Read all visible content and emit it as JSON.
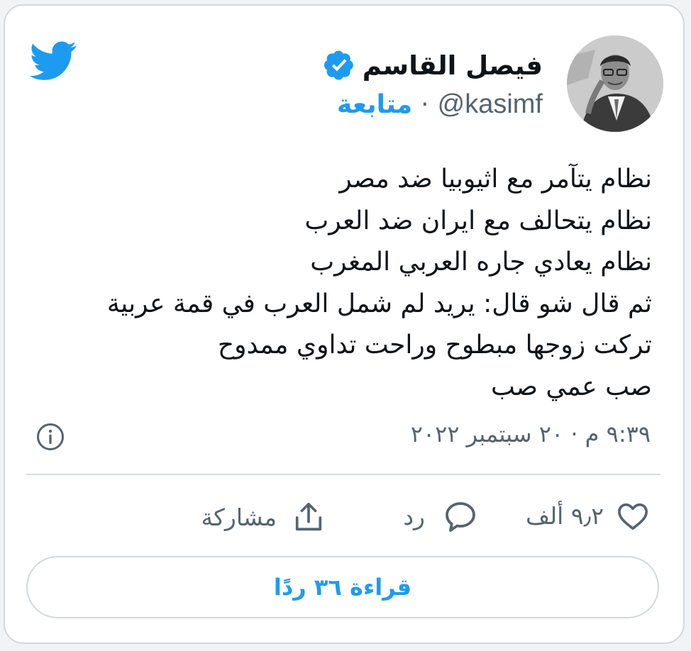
{
  "author": {
    "name": "فيصل القاسم",
    "handle": "@kasimf",
    "follow_label": "متابعة",
    "separator": "·",
    "verified": true
  },
  "tweet": {
    "lines": [
      "نظام  يتآمر مع اثيوبيا ضد مصر",
      "نظام يتحالف مع ايران ضد العرب",
      "نظام يعادي جاره العربي المغرب",
      "ثم قال شو قال: يريد لم شمل العرب في قمة عربية",
      "تركت زوجها مبطوح وراحت تداوي ممدوح",
      "صب عمي صب"
    ],
    "timestamp": "٩:٣٩ م · ٢٠ سبتمبر ٢٠٢٢"
  },
  "actions": {
    "like_count": "٩٫٢ ألف",
    "reply_label": "رد",
    "share_label": "مشاركة"
  },
  "read_replies_label": "قراءة ٣٦ ردًا",
  "icons": {
    "logo": "twitter-bird-icon",
    "verified": "verified-badge-icon",
    "info": "info-icon",
    "like": "heart-icon",
    "reply": "speech-bubble-icon",
    "share": "share-upload-icon"
  },
  "colors": {
    "accent": "#1d9bf0",
    "text": "#0f1419",
    "muted": "#536471",
    "border": "#cfd9de"
  }
}
